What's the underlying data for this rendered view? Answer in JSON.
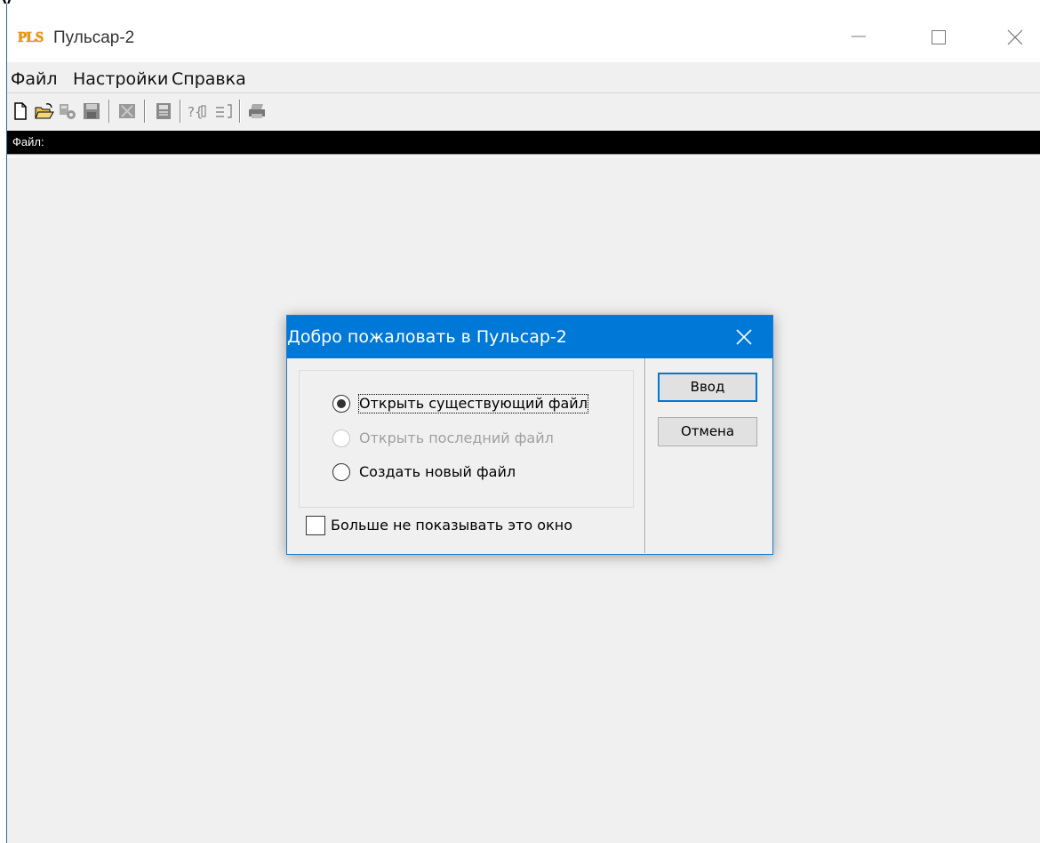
{
  "app": {
    "logo_text": "PLS",
    "title": "Пульсар-2"
  },
  "menu": {
    "items": [
      "Файл",
      "Настройки",
      "Справка"
    ]
  },
  "toolbar": {
    "icons": [
      "new-file-icon",
      "open-folder-icon",
      "settings-icon",
      "save-icon",
      "image-icon",
      "book-icon",
      "help-icon",
      "align-icon",
      "print-icon"
    ]
  },
  "file_bar": {
    "label": "Файл:"
  },
  "dialog": {
    "title": "Добро пожаловать в Пульсар-2",
    "options": [
      {
        "label": "Открыть существующий файл",
        "selected": true,
        "enabled": true
      },
      {
        "label": "Открыть последний файл",
        "selected": false,
        "enabled": false
      },
      {
        "label": "Создать новый файл",
        "selected": false,
        "enabled": true
      }
    ],
    "checkbox": {
      "label": "Больше не показывать это окно",
      "checked": false
    },
    "ok_label": "Ввод",
    "cancel_label": "Отмена"
  },
  "colors": {
    "dialog_title_bg": "#0078d7",
    "window_bg": "#f0f0f0",
    "file_bar_bg": "#000000"
  }
}
